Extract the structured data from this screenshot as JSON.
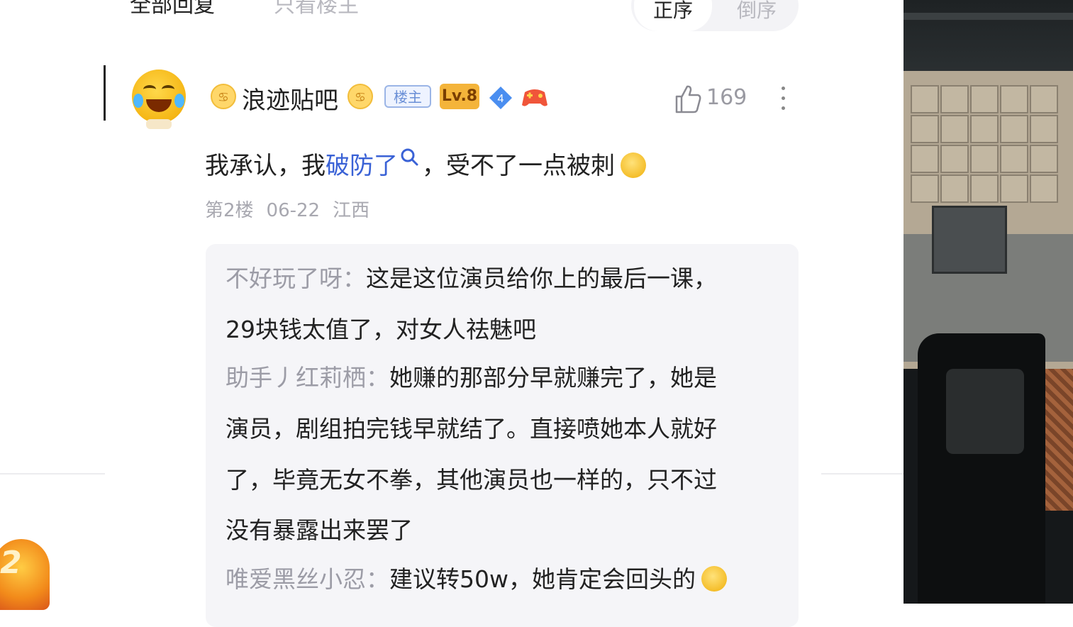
{
  "tabs": {
    "all_replies": "全部回复",
    "only_op": "只看楼主"
  },
  "sort": {
    "ascending": "正序",
    "descending": "倒序"
  },
  "post": {
    "username": "浪迹贴吧",
    "badge_op": "楼主",
    "badge_level": "Lv.8",
    "badge_diamond": "4",
    "like_count": "169",
    "content_before": "我承认，我",
    "content_link": "破防了",
    "content_after": "，受不了一点被刺",
    "floor": "第2楼",
    "date": "06-22",
    "location": "江西"
  },
  "replies": [
    {
      "name": "不好玩了呀：",
      "lines": [
        "这是这位演员给你上的最后一课，",
        "29块钱太值了，对女人祛魅吧"
      ]
    },
    {
      "name": "助手丿红莉栖：",
      "lines": [
        "她赚的那部分早就赚完了，她是",
        "演员，剧组拍完钱早就结了。直接喷她本人就好",
        "了，毕竟无女不拳，其他演员也一样的，只不过",
        "没有暴露出来罢了"
      ]
    },
    {
      "name": "唯爱黑丝小忍：",
      "lines": [
        "建议转50w，她肯定会回头的"
      ]
    }
  ],
  "corner_badge": "2",
  "icons": {
    "avatar": "laughing-tears-emoji",
    "crab": "cancer-zodiac-icon",
    "like": "thumbs-up-icon",
    "more": "vertical-dots-icon",
    "search": "search-icon",
    "diamond": "diamond-icon",
    "game": "gamepad-icon"
  },
  "colors": {
    "link": "#3a62d6",
    "meta": "#a8a8b0",
    "reply_bg": "#f5f5f8",
    "reply_name": "#9c9ca6"
  }
}
